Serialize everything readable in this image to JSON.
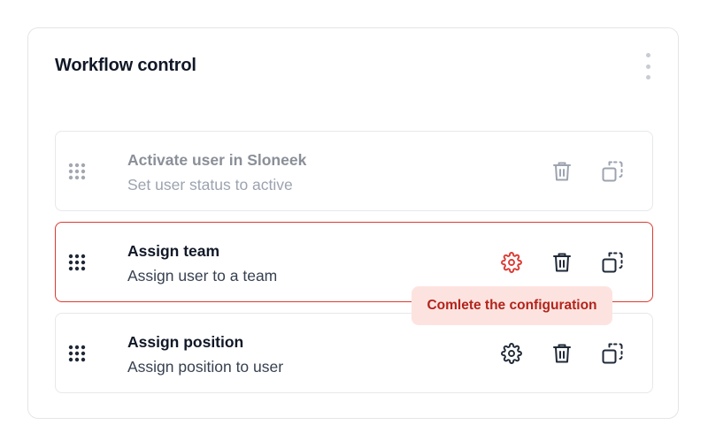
{
  "card": {
    "title": "Workflow control"
  },
  "steps": [
    {
      "title": "Activate user in Sloneek",
      "subtitle": "Set user status to active",
      "state": "disabled",
      "actions": [
        "trash-icon",
        "copy-icon"
      ]
    },
    {
      "title": "Assign team",
      "subtitle": "Assign user to a team",
      "state": "error",
      "actions": [
        "gear-icon",
        "trash-icon",
        "copy-icon"
      ]
    },
    {
      "title": "Assign position",
      "subtitle": "Assign position to user",
      "state": "normal",
      "actions": [
        "gear-icon",
        "trash-icon",
        "copy-icon"
      ]
    }
  ],
  "tooltip": {
    "text": "Comlete the configuration"
  },
  "colors": {
    "error": "#dc3a32",
    "tooltip_bg": "#fde3df",
    "tooltip_text": "#b1241c",
    "icon": "#1f2937",
    "icon_disabled": "#9ca3af"
  }
}
